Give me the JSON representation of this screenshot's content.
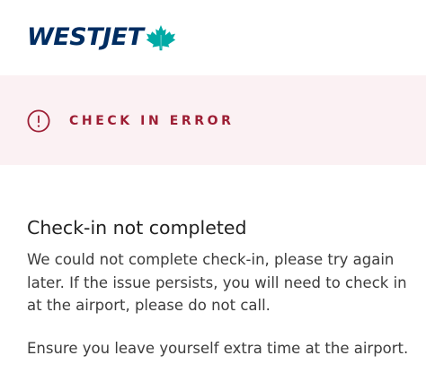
{
  "brand": {
    "logo_text": "WESTJET",
    "logo_icon": "maple-leaf-icon"
  },
  "error_banner": {
    "icon": "exclamation-circle-icon",
    "label": "CHECK IN ERROR"
  },
  "message": {
    "title": "Check-in not completed",
    "paragraph_1": "We could not complete check-in, please try again later. If the issue persists, you will need to check in at the airport, please do not call.",
    "paragraph_2": "Ensure you leave yourself extra time at the airport."
  },
  "colors": {
    "brand_navy": "#002d62",
    "brand_teal": "#00aaa5",
    "error_red": "#9d1e34",
    "error_banner_bg": "#fbf1f3"
  }
}
